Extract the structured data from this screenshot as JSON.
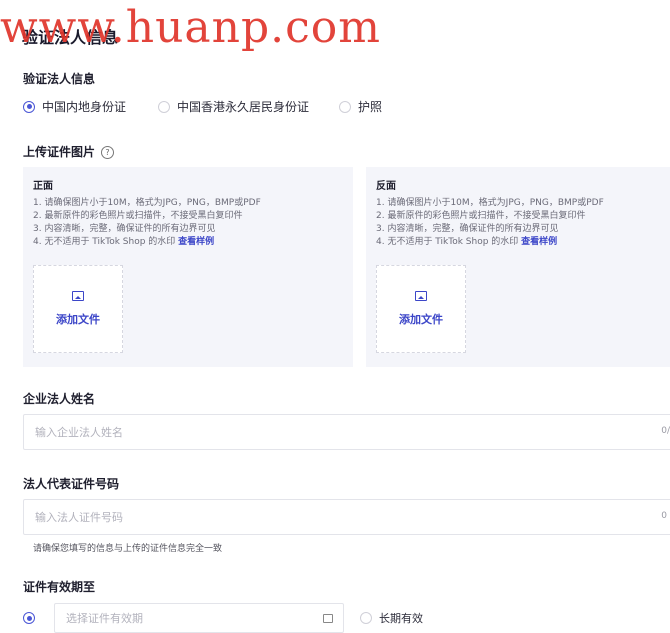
{
  "watermark": "www.huanp.com",
  "page_title": "验证法人信息",
  "id_type": {
    "label": "验证法人信息",
    "options": [
      {
        "label": "中国内地身份证",
        "checked": true
      },
      {
        "label": "中国香港永久居民身份证",
        "checked": false
      },
      {
        "label": "护照",
        "checked": false
      }
    ]
  },
  "upload": {
    "label": "上传证件图片",
    "help_glyph": "?",
    "front": {
      "title": "正面",
      "rules": [
        "1. 请确保图片小于10M，格式为JPG，PNG，BMP或PDF",
        "2. 最新原件的彩色照片或扫描件，不接受黑白复印件",
        "3. 内容清晰，完整，确保证件的所有边界可见",
        "4. 无不适用于 TikTok Shop 的水印 "
      ],
      "example_link": "查看样例",
      "add_file": "添加文件"
    },
    "back": {
      "title": "反面",
      "rules": [
        "1. 请确保图片小于10M，格式为JPG，PNG，BMP或PDF",
        "2. 最新原件的彩色照片或扫描件，不接受黑白复印件",
        "3. 内容清晰，完整，确保证件的所有边界可见",
        "4. 无不适用于 TikTok Shop 的水印 "
      ],
      "example_link": "查看样例",
      "add_file": "添加文件"
    }
  },
  "legal_name": {
    "label": "企业法人姓名",
    "placeholder": "输入企业法人姓名",
    "counter": "0/"
  },
  "id_number": {
    "label": "法人代表证件号码",
    "placeholder": "输入法人证件号码",
    "counter": "0",
    "hint": "请确保您填写的信息与上传的证件信息完全一致"
  },
  "expiry": {
    "label": "证件有效期至",
    "date_placeholder": "选择证件有效期",
    "long_term": "长期有效",
    "date_checked": true
  },
  "colors": {
    "accent": "#3c46c8",
    "watermark": "#e0352b",
    "card_bg": "#f4f5fa"
  }
}
